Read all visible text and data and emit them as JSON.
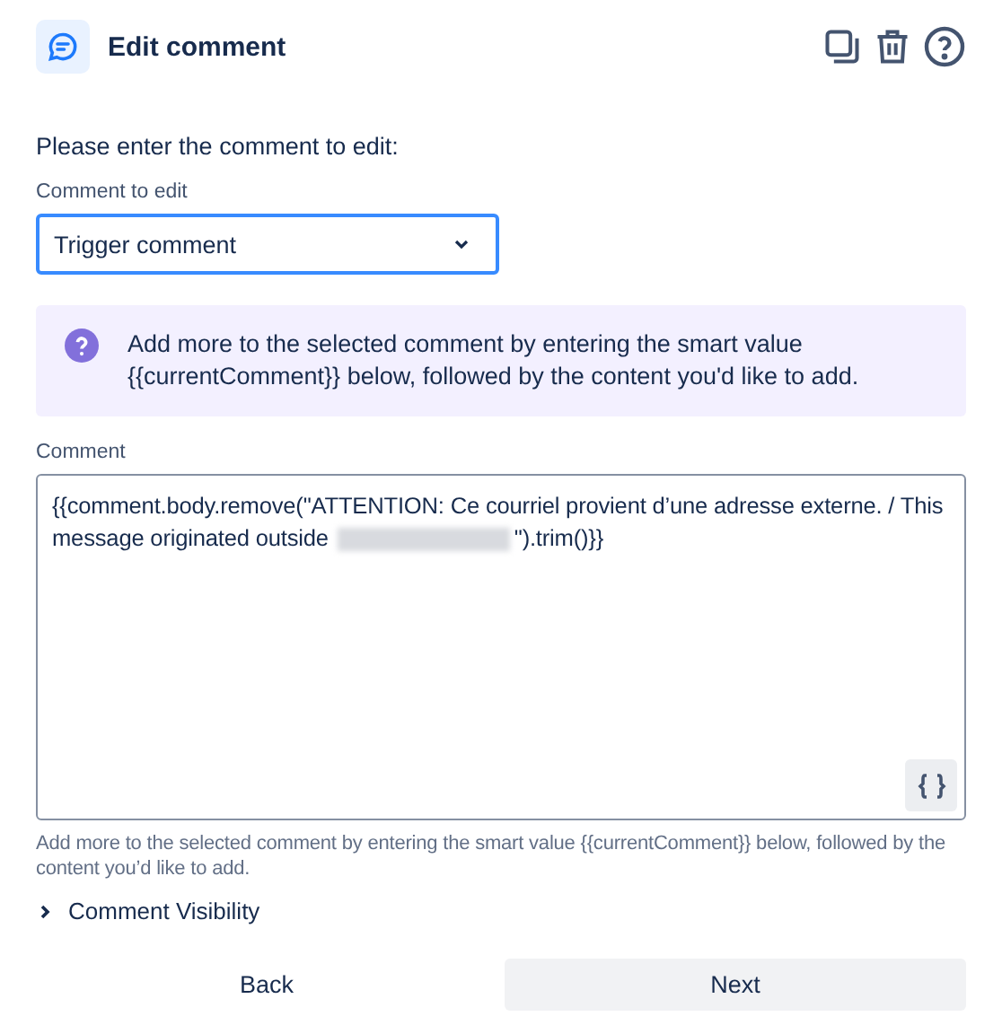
{
  "header": {
    "title": "Edit comment"
  },
  "prompt": "Please enter the comment to edit:",
  "select": {
    "label": "Comment to edit",
    "value": "Trigger comment",
    "focused": true
  },
  "info": "Add more to the selected comment by entering the smart value {{currentComment}} below, followed by the content you'd like to add.",
  "comment": {
    "label": "Comment",
    "value_before": "{{comment.body.remove(\"ATTENTION: Ce courriel provient d’une adresse externe. / This message originated outside",
    "value_after": "\").trim()}}",
    "helper": "Add more to the selected comment by entering the smart value {{currentComment}} below, followed by the content you’d like to add."
  },
  "visibility": {
    "label": "Comment Visibility",
    "expanded": false
  },
  "buttons": [
    {
      "label": "Back",
      "kind": "subtle"
    },
    {
      "label": "Next",
      "kind": "default"
    }
  ]
}
